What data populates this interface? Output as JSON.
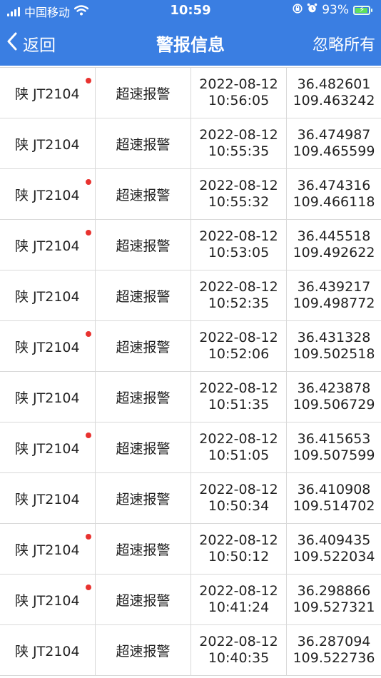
{
  "status_bar": {
    "carrier": "中国移动",
    "time": "10:59",
    "battery_percent": "93%",
    "icons": [
      "signal-icon",
      "wifi-icon",
      "orientation-lock-icon",
      "alarm-icon",
      "battery-charging-icon"
    ]
  },
  "nav": {
    "back_label": "返回",
    "title": "警报信息",
    "ignore_all_label": "忽略所有"
  },
  "colors": {
    "primary": "#3a7ee2",
    "unread_dot": "#e8322f",
    "divider": "#d9d9d9"
  },
  "alerts": [
    {
      "plate": "陕 JT2104",
      "type": "超速报警",
      "date": "2022-08-12",
      "time": "10:56:05",
      "lat": "36.482601",
      "lng": "109.463242",
      "unread": true
    },
    {
      "plate": "陕 JT2104",
      "type": "超速报警",
      "date": "2022-08-12",
      "time": "10:55:35",
      "lat": "36.474987",
      "lng": "109.465599",
      "unread": false
    },
    {
      "plate": "陕 JT2104",
      "type": "超速报警",
      "date": "2022-08-12",
      "time": "10:55:32",
      "lat": "36.474316",
      "lng": "109.466118",
      "unread": true
    },
    {
      "plate": "陕 JT2104",
      "type": "超速报警",
      "date": "2022-08-12",
      "time": "10:53:05",
      "lat": "36.445518",
      "lng": "109.492622",
      "unread": true
    },
    {
      "plate": "陕 JT2104",
      "type": "超速报警",
      "date": "2022-08-12",
      "time": "10:52:35",
      "lat": "36.439217",
      "lng": "109.498772",
      "unread": false
    },
    {
      "plate": "陕 JT2104",
      "type": "超速报警",
      "date": "2022-08-12",
      "time": "10:52:06",
      "lat": "36.431328",
      "lng": "109.502518",
      "unread": true
    },
    {
      "plate": "陕 JT2104",
      "type": "超速报警",
      "date": "2022-08-12",
      "time": "10:51:35",
      "lat": "36.423878",
      "lng": "109.506729",
      "unread": false
    },
    {
      "plate": "陕 JT2104",
      "type": "超速报警",
      "date": "2022-08-12",
      "time": "10:51:05",
      "lat": "36.415653",
      "lng": "109.507599",
      "unread": true
    },
    {
      "plate": "陕 JT2104",
      "type": "超速报警",
      "date": "2022-08-12",
      "time": "10:50:34",
      "lat": "36.410908",
      "lng": "109.514702",
      "unread": false
    },
    {
      "plate": "陕 JT2104",
      "type": "超速报警",
      "date": "2022-08-12",
      "time": "10:50:12",
      "lat": "36.409435",
      "lng": "109.522034",
      "unread": true
    },
    {
      "plate": "陕 JT2104",
      "type": "超速报警",
      "date": "2022-08-12",
      "time": "10:41:24",
      "lat": "36.298866",
      "lng": "109.527321",
      "unread": true
    },
    {
      "plate": "陕 JT2104",
      "type": "超速报警",
      "date": "2022-08-12",
      "time": "10:40:35",
      "lat": "36.287094",
      "lng": "109.522736",
      "unread": false
    }
  ]
}
